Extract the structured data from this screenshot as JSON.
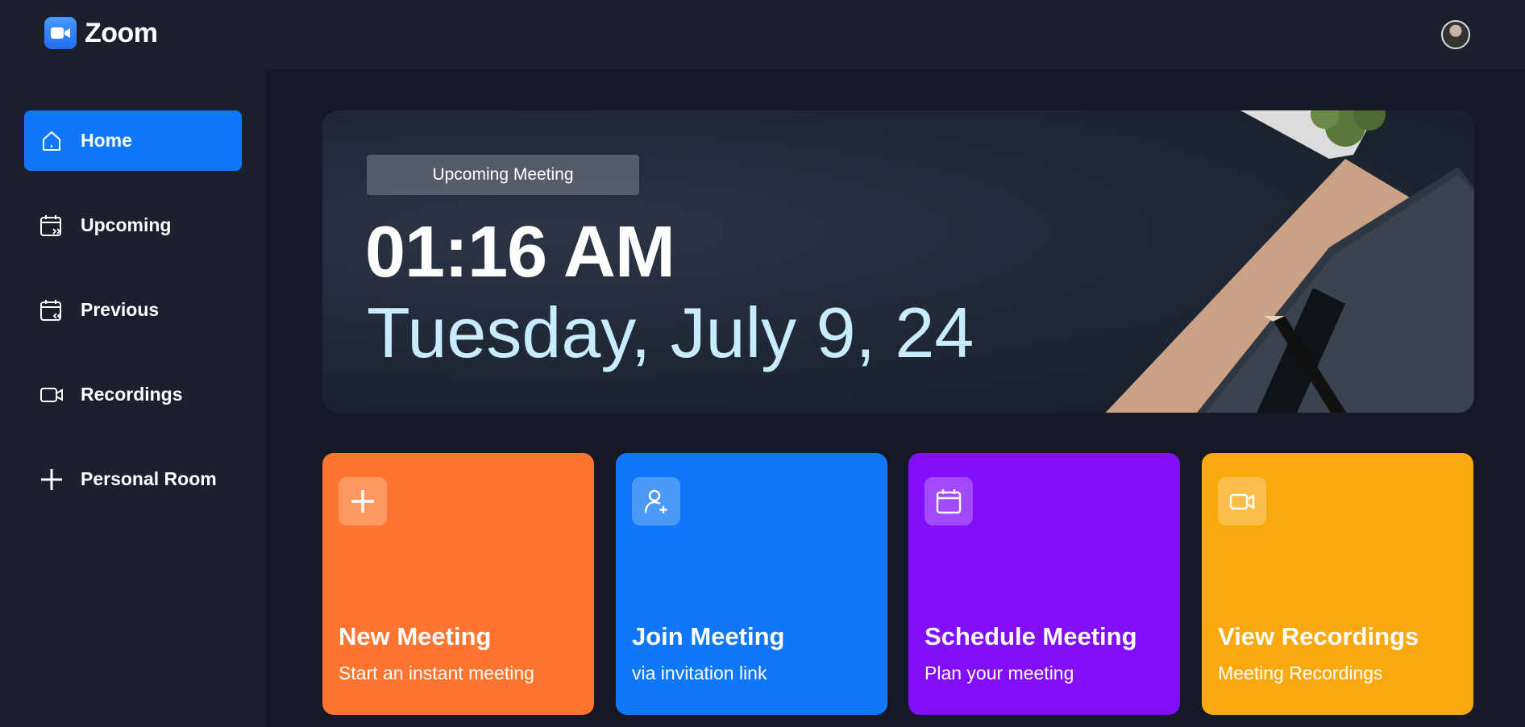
{
  "app": {
    "name": "Zoom"
  },
  "sidebar": {
    "items": [
      {
        "label": "Home",
        "icon": "home-icon",
        "active": true
      },
      {
        "label": "Upcoming",
        "icon": "calendar-upcoming-icon",
        "active": false
      },
      {
        "label": "Previous",
        "icon": "calendar-previous-icon",
        "active": false
      },
      {
        "label": "Recordings",
        "icon": "video-icon",
        "active": false
      },
      {
        "label": "Personal Room",
        "icon": "plus-icon",
        "active": false
      }
    ]
  },
  "hero": {
    "badge": "Upcoming Meeting",
    "time": "01:16 AM",
    "date": "Tuesday, July 9, 24"
  },
  "cards": [
    {
      "title": "New Meeting",
      "subtitle": "Start an instant meeting",
      "icon": "plus-icon",
      "color": "#ff742e"
    },
    {
      "title": "Join Meeting",
      "subtitle": "via invitation link",
      "icon": "add-user-icon",
      "color": "#0e78f9"
    },
    {
      "title": "Schedule Meeting",
      "subtitle": "Plan your meeting",
      "icon": "calendar-icon",
      "color": "#830ef9"
    },
    {
      "title": "View Recordings",
      "subtitle": "Meeting Recordings",
      "icon": "video-icon",
      "color": "#f9a90e"
    }
  ],
  "colors": {
    "background": "#1c1f2e",
    "main": "#161925",
    "accent": "#0e78f9",
    "date_text": "#c9ebff"
  }
}
